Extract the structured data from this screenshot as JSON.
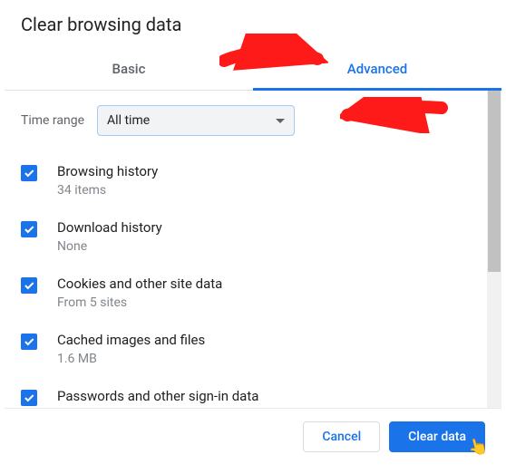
{
  "title": "Clear browsing data",
  "tabs": {
    "basic": "Basic",
    "advanced": "Advanced"
  },
  "timeRange": {
    "label": "Time range",
    "value": "All time"
  },
  "items": [
    {
      "label": "Browsing history",
      "sub": "34 items"
    },
    {
      "label": "Download history",
      "sub": "None"
    },
    {
      "label": "Cookies and other site data",
      "sub": "From 5 sites"
    },
    {
      "label": "Cached images and files",
      "sub": "1.6 MB"
    },
    {
      "label": "Passwords and other sign-in data",
      "sub": ""
    }
  ],
  "buttons": {
    "cancel": "Cancel",
    "clear": "Clear data"
  },
  "colors": {
    "accent": "#1a73e8"
  }
}
